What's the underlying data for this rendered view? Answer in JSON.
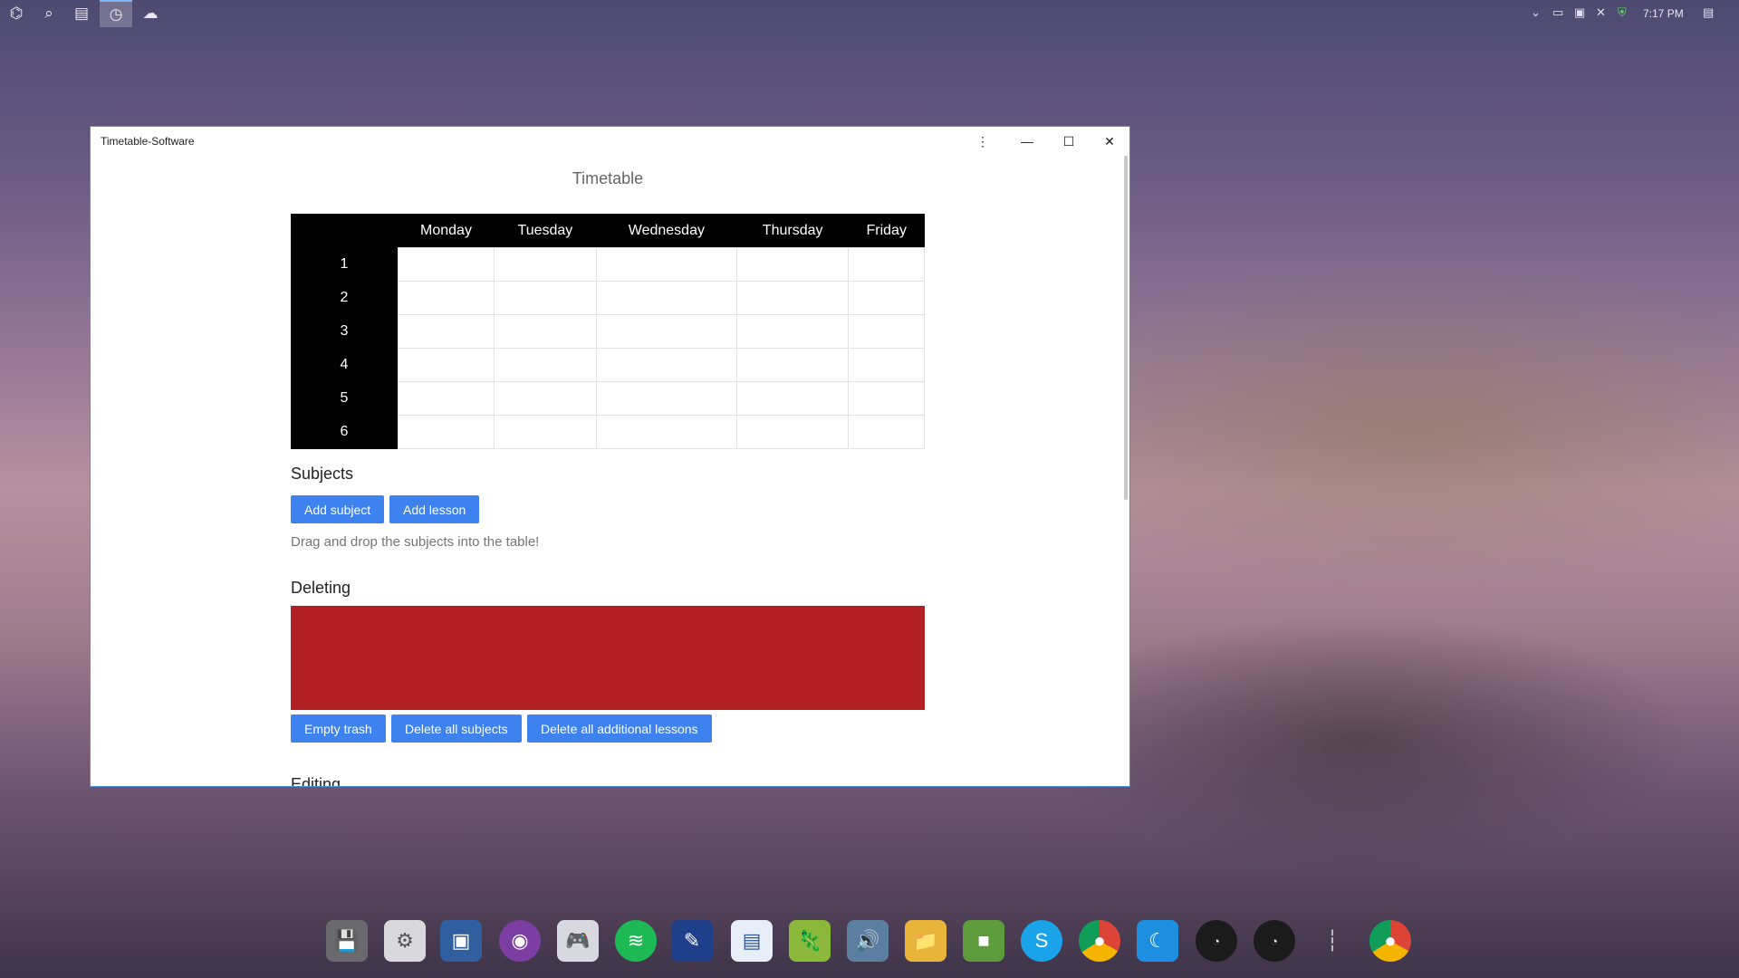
{
  "taskbar": {
    "icons": [
      "start-icon",
      "search-icon",
      "task-view-icon",
      "clock-app-icon",
      "cloud-app-icon"
    ],
    "time": "7:17 PM"
  },
  "window": {
    "title": "Timetable-Software",
    "page_title": "Timetable",
    "timetable": {
      "days": [
        "Monday",
        "Tuesday",
        "Wednesday",
        "Thursday",
        "Friday"
      ],
      "periods": [
        "1",
        "2",
        "3",
        "4",
        "5",
        "6"
      ]
    },
    "subjects": {
      "heading": "Subjects",
      "add_subject_label": "Add subject",
      "add_lesson_label": "Add lesson",
      "hint": "Drag and drop the subjects into the table!"
    },
    "deleting": {
      "heading": "Deleting",
      "trash_color": "#b21f24",
      "empty_trash_label": "Empty trash",
      "delete_all_subjects_label": "Delete all subjects",
      "delete_additional_label": "Delete all additional lessons"
    },
    "editing": {
      "heading": "Editing"
    }
  },
  "colors": {
    "accent": "#3d82ee",
    "header": "#000000",
    "trash": "#b21f24"
  },
  "dock": {
    "items": [
      "save-icon",
      "settings-icon",
      "virtualbox-icon",
      "github-icon",
      "gamepad-icon",
      "spotify-icon",
      "paint-icon",
      "document-icon",
      "chameleon-icon",
      "speaker-icon",
      "folder-icon",
      "minecraft-icon",
      "skype-icon",
      "chrome-icon",
      "monitor-icon",
      "cpu-gauge-icon",
      "memory-gauge-icon",
      "divider-icon",
      "chrome-icon-2"
    ]
  }
}
